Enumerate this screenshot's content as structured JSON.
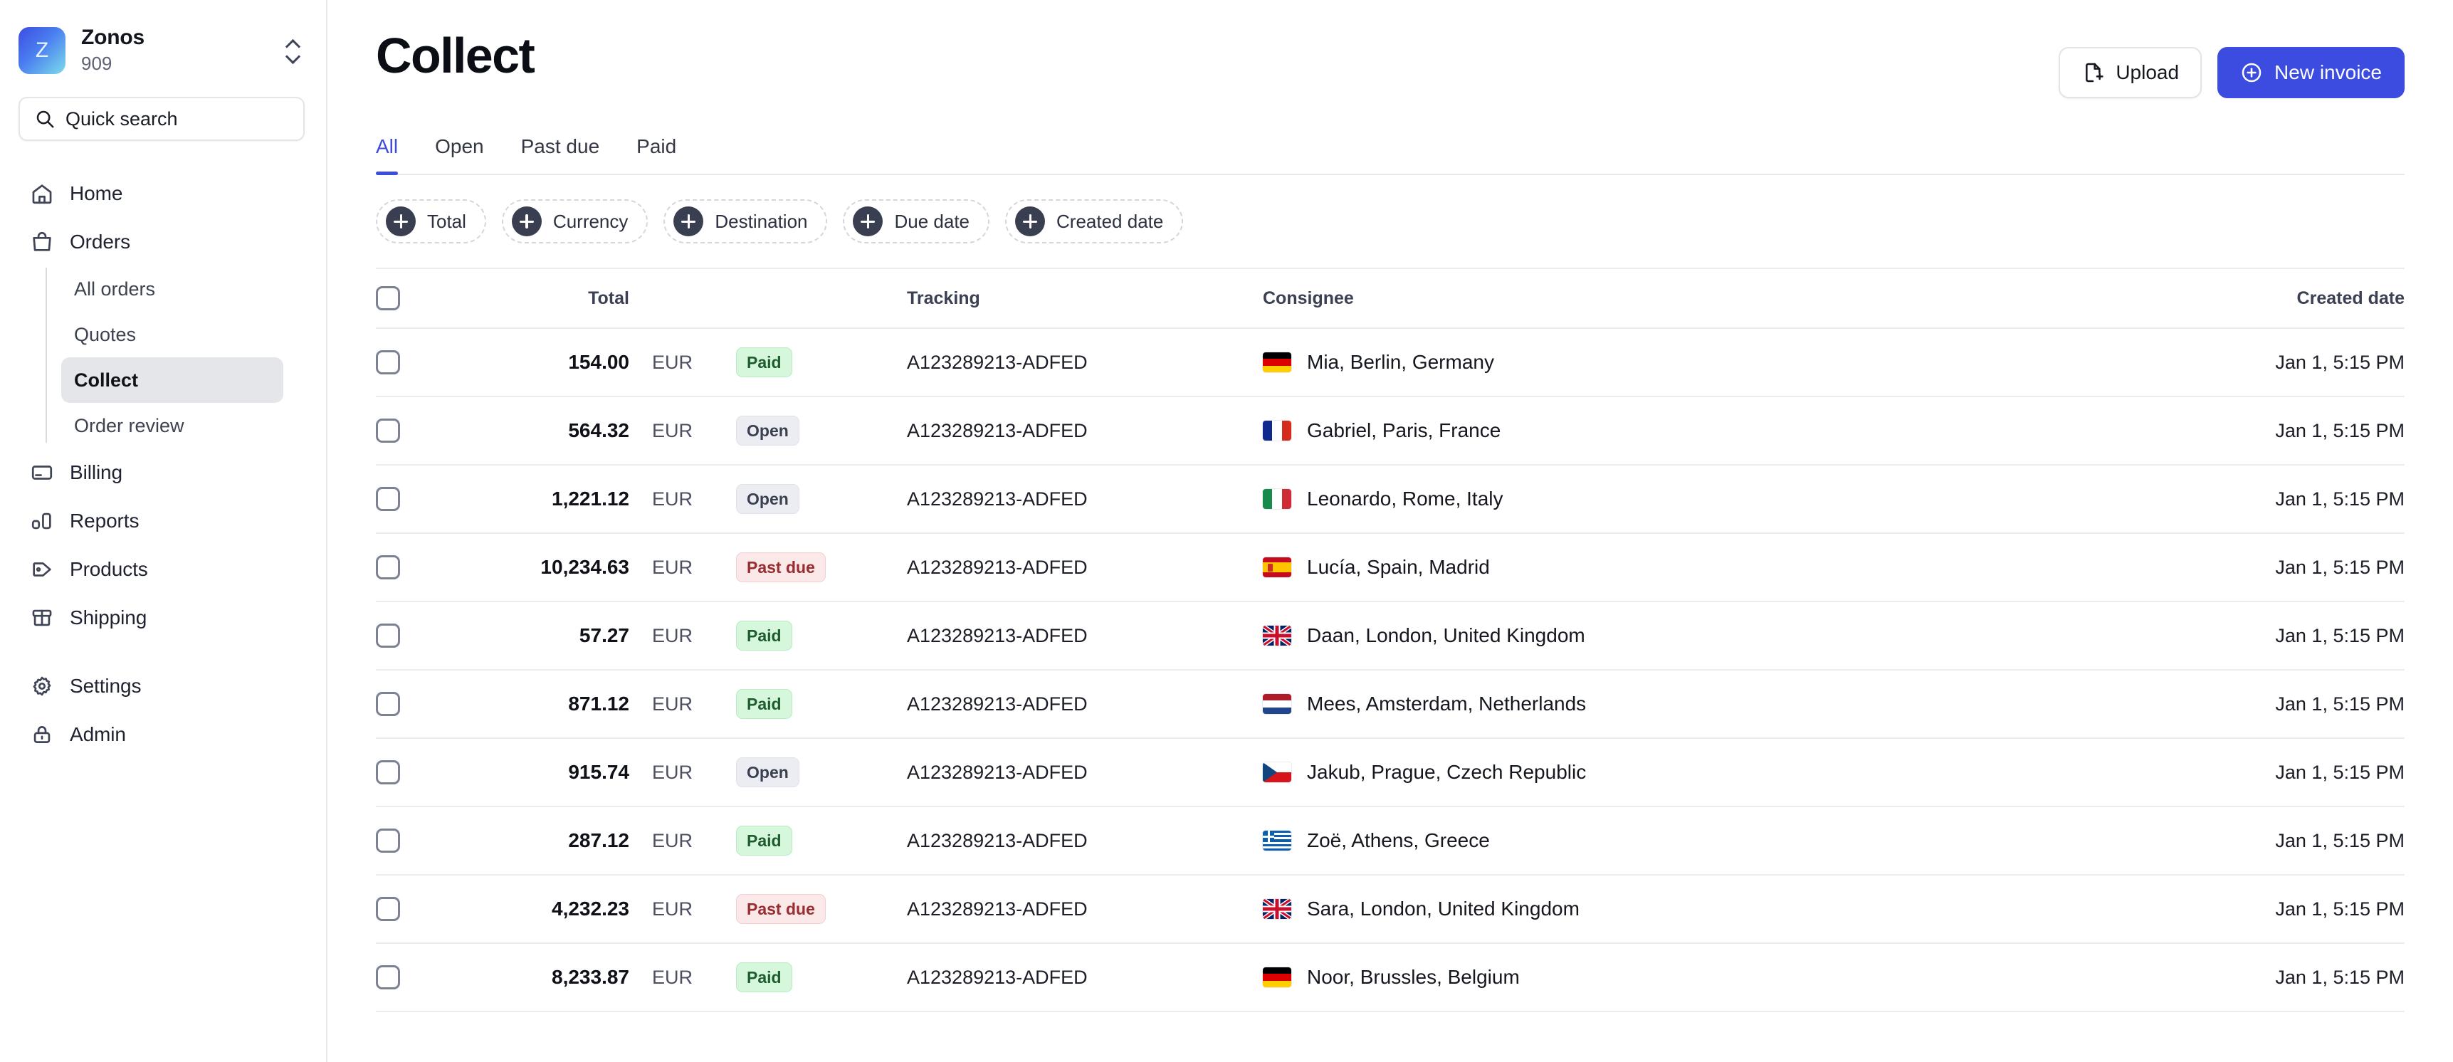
{
  "sidebar": {
    "brand": {
      "logo_letter": "Z",
      "name": "Zonos",
      "sub": "909",
      "toggle_icon": "chevron-up-down-icon"
    },
    "search": {
      "placeholder": "Quick search",
      "icon": "search-icon"
    },
    "nav": [
      {
        "label": "Home",
        "icon": "home-icon",
        "active": false
      },
      {
        "label": "Orders",
        "icon": "bag-icon",
        "active": false
      }
    ],
    "sub_items": [
      {
        "label": "All orders",
        "active": false
      },
      {
        "label": "Quotes",
        "active": false
      },
      {
        "label": "Collect",
        "active": true
      },
      {
        "label": "Order review",
        "active": false
      }
    ],
    "nav_rest": [
      {
        "label": "Billing",
        "icon": "credit-card-icon"
      },
      {
        "label": "Reports",
        "icon": "bar-chart-icon"
      },
      {
        "label": "Products",
        "icon": "tag-icon"
      },
      {
        "label": "Shipping",
        "icon": "box-icon"
      }
    ],
    "nav_bottom": [
      {
        "label": "Settings",
        "icon": "gear-icon"
      },
      {
        "label": "Admin",
        "icon": "lock-icon"
      }
    ]
  },
  "header": {
    "title": "Collect",
    "upload_label": "Upload",
    "upload_icon": "file-plus-icon",
    "new_invoice_label": "New invoice",
    "new_invoice_icon": "plus-circle-icon",
    "primary_color": "#3d4ce0"
  },
  "tabs": [
    {
      "label": "All",
      "active": true
    },
    {
      "label": "Open",
      "active": false
    },
    {
      "label": "Past due",
      "active": false
    },
    {
      "label": "Paid",
      "active": false
    }
  ],
  "filters": [
    {
      "label": "Total",
      "icon": "plus-circle-icon"
    },
    {
      "label": "Currency",
      "icon": "plus-circle-icon"
    },
    {
      "label": "Destination",
      "icon": "plus-circle-icon"
    },
    {
      "label": "Due date",
      "icon": "plus-circle-icon"
    },
    {
      "label": "Created date",
      "icon": "plus-circle-icon"
    }
  ],
  "table": {
    "columns": {
      "total": "Total",
      "tracking": "Tracking",
      "consignee": "Consignee",
      "created_date": "Created date"
    },
    "rows": [
      {
        "total": "154.00",
        "currency": "EUR",
        "status": "Paid",
        "status_kind": "paid",
        "tracking": "A123289213-ADFED",
        "flag": "de",
        "consignee": "Mia, Berlin, Germany",
        "created_date": "Jan 1, 5:15 PM"
      },
      {
        "total": "564.32",
        "currency": "EUR",
        "status": "Open",
        "status_kind": "open",
        "tracking": "A123289213-ADFED",
        "flag": "fr",
        "consignee": "Gabriel, Paris, France",
        "created_date": "Jan 1, 5:15 PM"
      },
      {
        "total": "1,221.12",
        "currency": "EUR",
        "status": "Open",
        "status_kind": "open",
        "tracking": "A123289213-ADFED",
        "flag": "it",
        "consignee": "Leonardo, Rome, Italy",
        "created_date": "Jan 1, 5:15 PM"
      },
      {
        "total": "10,234.63",
        "currency": "EUR",
        "status": "Past due",
        "status_kind": "pastdue",
        "tracking": "A123289213-ADFED",
        "flag": "es",
        "consignee": "Lucía, Spain, Madrid",
        "created_date": "Jan 1, 5:15 PM"
      },
      {
        "total": "57.27",
        "currency": "EUR",
        "status": "Paid",
        "status_kind": "paid",
        "tracking": "A123289213-ADFED",
        "flag": "gb",
        "consignee": "Daan, London, United Kingdom",
        "created_date": "Jan 1, 5:15 PM"
      },
      {
        "total": "871.12",
        "currency": "EUR",
        "status": "Paid",
        "status_kind": "paid",
        "tracking": "A123289213-ADFED",
        "flag": "nl",
        "consignee": "Mees, Amsterdam, Netherlands",
        "created_date": "Jan 1, 5:15 PM"
      },
      {
        "total": "915.74",
        "currency": "EUR",
        "status": "Open",
        "status_kind": "open",
        "tracking": "A123289213-ADFED",
        "flag": "cz",
        "consignee": "Jakub, Prague, Czech Republic",
        "created_date": "Jan 1, 5:15 PM"
      },
      {
        "total": "287.12",
        "currency": "EUR",
        "status": "Paid",
        "status_kind": "paid",
        "tracking": "A123289213-ADFED",
        "flag": "gr",
        "consignee": "Zoë, Athens, Greece",
        "created_date": "Jan 1, 5:15 PM"
      },
      {
        "total": "4,232.23",
        "currency": "EUR",
        "status": "Past due",
        "status_kind": "pastdue",
        "tracking": "A123289213-ADFED",
        "flag": "gb",
        "consignee": "Sara,  London, United Kingdom",
        "created_date": "Jan 1, 5:15 PM"
      },
      {
        "total": "8,233.87",
        "currency": "EUR",
        "status": "Paid",
        "status_kind": "paid",
        "tracking": "A123289213-ADFED",
        "flag": "de",
        "consignee": "Noor, Brussles, Belgium",
        "created_date": "Jan 1, 5:15 PM"
      }
    ]
  }
}
